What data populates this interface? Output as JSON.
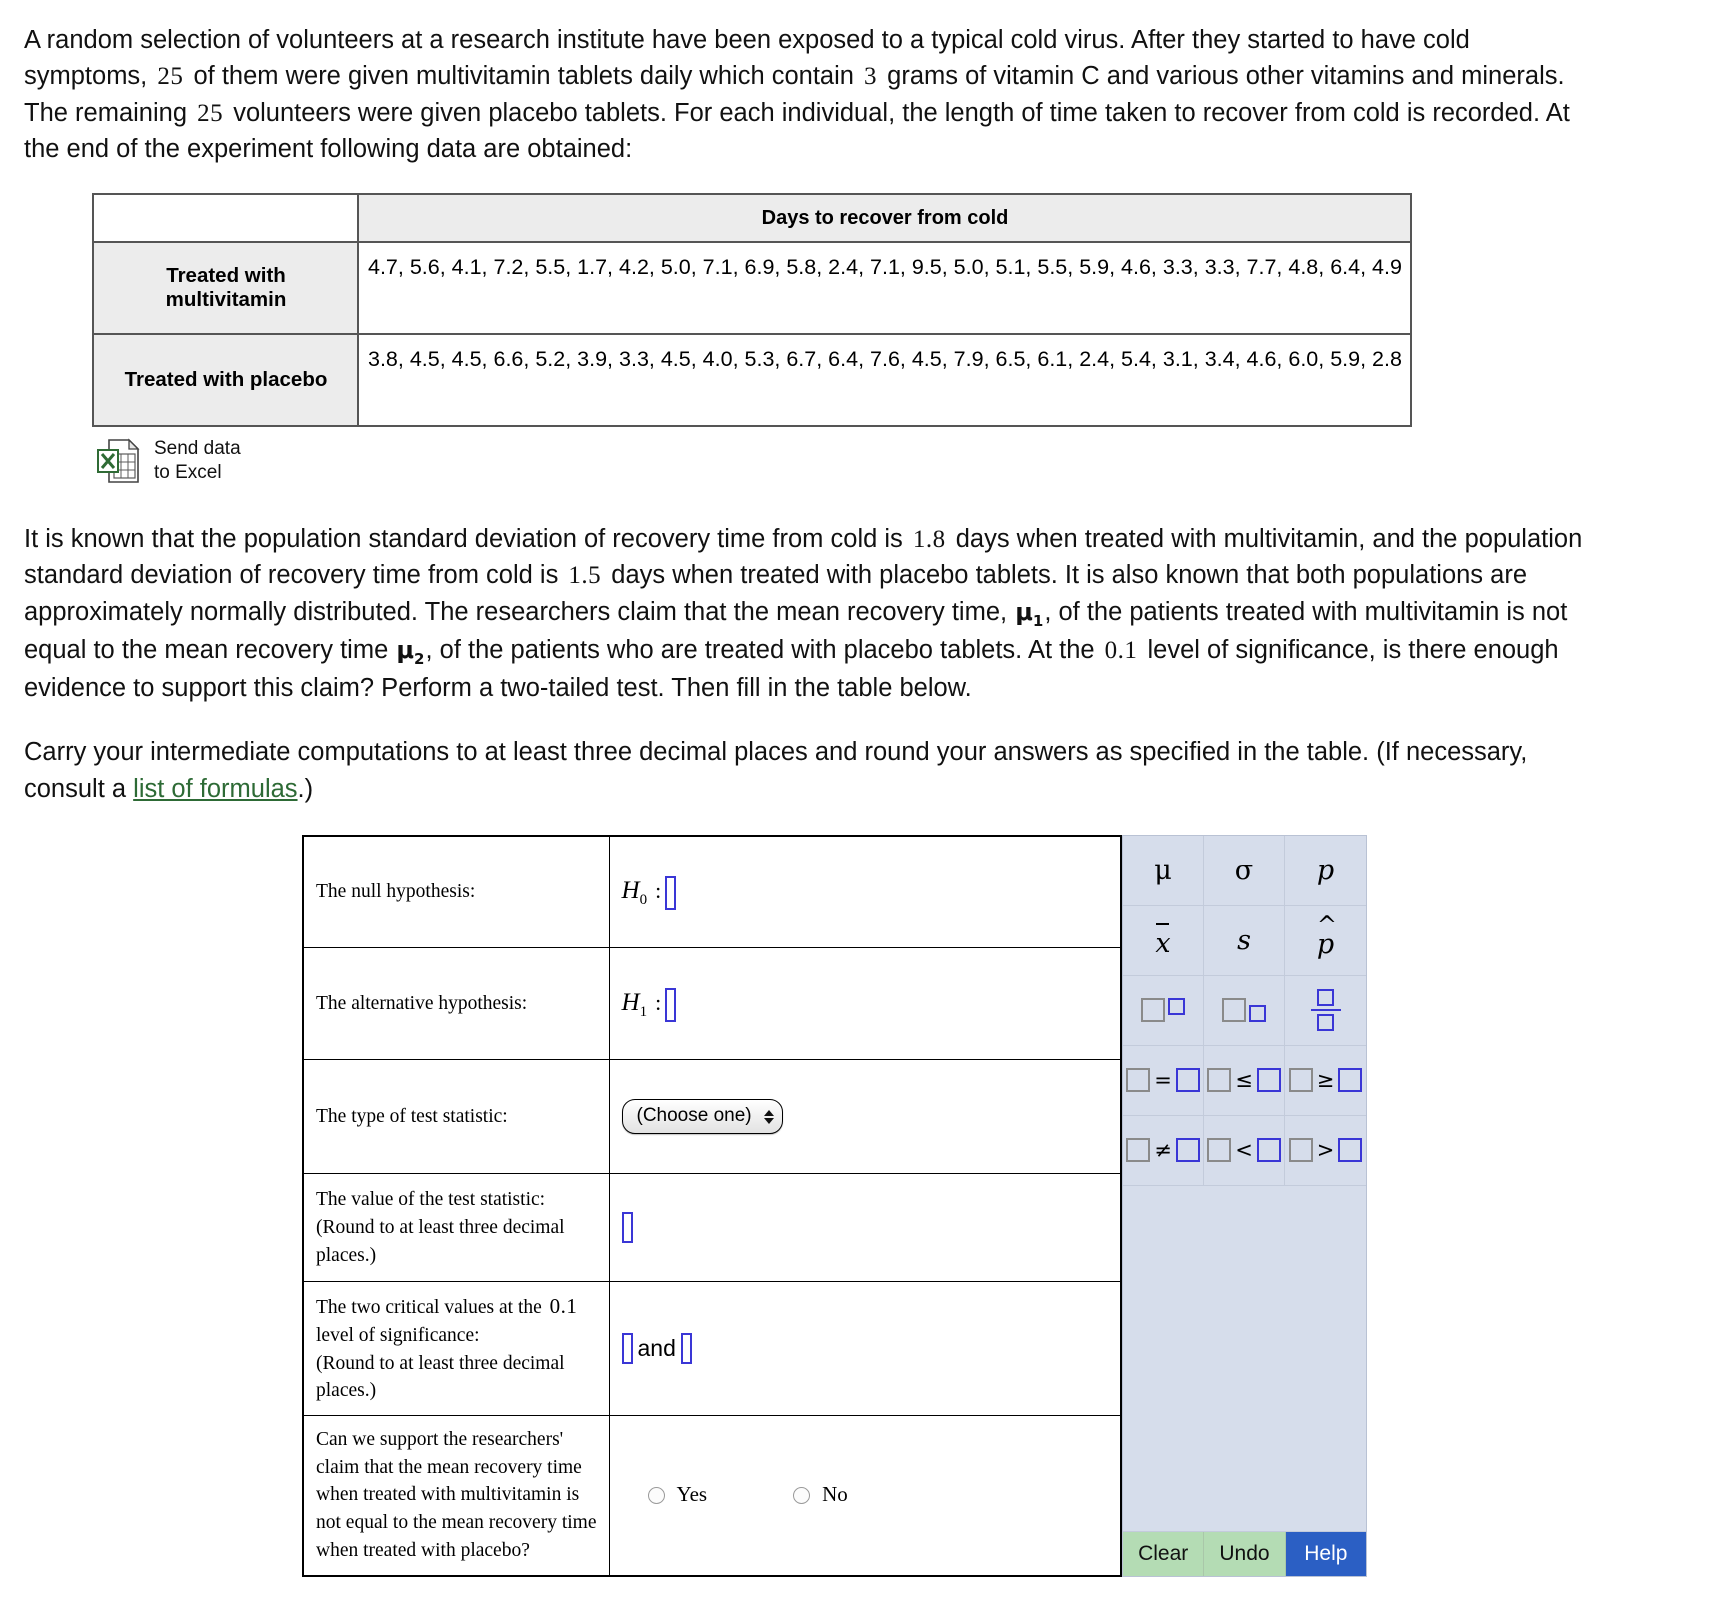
{
  "intro": {
    "part1": "A random selection of volunteers at a research institute have been exposed to a typical cold virus. After they started to have cold symptoms,",
    "n1": "25",
    "part2": "of them were given multivitamin tablets daily which contain",
    "grams": "3",
    "part3": "grams of vitamin C and various other vitamins and minerals. The remaining",
    "n2": "25",
    "part4": "volunteers were given placebo tablets. For each individual, the length of time taken to recover from cold is recorded. At the end of the experiment following data are obtained:"
  },
  "data_table": {
    "header": "Days to recover from cold",
    "rows": [
      {
        "label": "Treated with multivitamin",
        "values": "4.7, 5.6, 4.1, 7.2, 5.5, 1.7, 4.2, 5.0, 7.1, 6.9, 5.8, 2.4, 7.1, 9.5, 5.0, 5.1, 5.5, 5.9, 4.6, 3.3, 3.3, 7.7, 4.8, 6.4, 4.9"
      },
      {
        "label": "Treated with placebo",
        "values": "3.8, 4.5, 4.5, 6.6, 5.2, 3.9, 3.3, 4.5, 4.0, 5.3, 6.7, 6.4, 7.6, 4.5, 7.9, 6.5, 6.1, 2.4, 5.4, 3.1, 3.4, 4.6, 6.0, 5.9, 2.8"
      }
    ]
  },
  "excel": {
    "line1": "Send data",
    "line2": "to Excel",
    "icon": "excel-file-icon"
  },
  "body": {
    "s1": "It is known that the population standard deviation of recovery time from cold is",
    "sd1": "1.8",
    "s2": "days when treated with multivitamin, and the population standard deviation of recovery time from cold is",
    "sd2": "1.5",
    "s3": "days when treated with placebo tablets. It is also known that both populations are approximately normally distributed. The researchers claim that the mean recovery time,",
    "mu1": "μ",
    "mu1_sub": "1",
    "s4": ", of the patients treated with multivitamin is not equal to the mean recovery time",
    "mu2": "μ",
    "mu2_sub": "2",
    "s5": ", of the patients who are treated with placebo tablets. At the",
    "alpha": "0.1",
    "s6": "level of significance, is there enough evidence to support this claim? Perform a two-tailed test. Then fill in the table below.",
    "s7": "Carry your intermediate computations to at least three decimal places and round your answers as specified in the table. (If necessary, consult a",
    "link": "list of formulas",
    "s8": ".)"
  },
  "answer_table": {
    "null_hypothesis_label": "The null hypothesis:",
    "null_symbol": "H",
    "null_sub": "0",
    "alt_hypothesis_label": "The alternative hypothesis:",
    "alt_symbol": "H",
    "alt_sub": "1",
    "type_label": "The type of test statistic:",
    "type_value": "(Choose one)",
    "value_label_line1": "The value of the test statistic:",
    "value_label_line2": "(Round to at least three decimal places.)",
    "critical_line1_a": "The two critical values at the",
    "critical_alpha": "0.1",
    "critical_line2": "level of significance:",
    "critical_line3": "(Round to at least three decimal places.)",
    "and_word": "and",
    "final_question": "Can we support the researchers' claim that the mean recovery time when treated with multivitamin is not equal to the mean recovery time when treated with placebo?",
    "option_yes": "Yes",
    "option_no": "No"
  },
  "keypad": {
    "keys": [
      {
        "name": "mu-key",
        "glyph": "μ"
      },
      {
        "name": "sigma-key",
        "glyph": "σ"
      },
      {
        "name": "p-key",
        "glyph": "p"
      },
      {
        "name": "x-bar-key",
        "glyph": "x"
      },
      {
        "name": "s-key",
        "glyph": "s"
      },
      {
        "name": "p-hat-key",
        "glyph": "p"
      },
      {
        "name": "superscript-template-key",
        "glyph": "□□"
      },
      {
        "name": "subscript-template-key",
        "glyph": "□□"
      },
      {
        "name": "fraction-template-key",
        "glyph": "□/□"
      },
      {
        "name": "equals-key",
        "glyph": "="
      },
      {
        "name": "less-equal-key",
        "glyph": "≤"
      },
      {
        "name": "greater-equal-key",
        "glyph": "≥"
      },
      {
        "name": "not-equal-key",
        "glyph": "≠"
      },
      {
        "name": "less-than-key",
        "glyph": "<"
      },
      {
        "name": "greater-than-key",
        "glyph": ">"
      }
    ],
    "clear": "Clear",
    "undo": "Undo",
    "help": "Help",
    "colors": {
      "panel": "#d6ddeb",
      "action_green": "#b4dcb4",
      "help_blue": "#2b5fc4",
      "answer_box_border": "#3a36d6",
      "link_green": "#2d6a35"
    }
  }
}
